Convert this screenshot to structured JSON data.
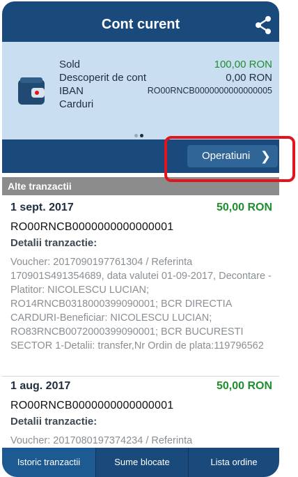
{
  "header": {
    "title": "Cont curent",
    "share_icon": "share-icon"
  },
  "account": {
    "icon": "wallet-icon",
    "sold_label": "Sold",
    "sold_value": "100,00 RON",
    "overdraft_label": "Descoperit de cont",
    "overdraft_value": "0,00 RON",
    "iban_label": "IBAN",
    "iban_value": "RO00RNCB0000000000000005",
    "cards_label": "Carduri",
    "pager": {
      "pages": 2,
      "active": 2
    }
  },
  "operations_button": {
    "label": "Operatiuni",
    "icon": "chevron-right-icon"
  },
  "section_title": "Alte tranzactii",
  "transactions": [
    {
      "date": "1 sept. 2017",
      "amount": "50,00 RON",
      "iban": "RO00RNCB0000000000000001",
      "details_label": "Detalii tranzactie:",
      "description": "Voucher: 2017090197761304 / Referinta 170901S491354689, data valutei 01-09-2017, Decontare -Platitor: NICOLESCU LUCIAN; RO14RNCB0318000399090001; BCR DIRECTIA CARDURI-Beneficiar: NICOLESCU LUCIAN; RO83RNCB0072000399090001; BCR BUCURESTI SECTOR 1-Detalii: transfer,Nr Ordin de plata:119796562"
    },
    {
      "date": "1 aug. 2017",
      "amount": "50,00 RON",
      "iban": "RO00RNCB0000000000000001",
      "details_label": "Detalii tranzactie:",
      "description": "Voucher: 2017080197374234 / Referinta"
    }
  ],
  "tabs": [
    {
      "label": "Istoric tranzactii",
      "active": true
    },
    {
      "label": "Sume blocate",
      "active": false
    },
    {
      "label": "Lista ordine",
      "active": false
    }
  ],
  "colors": {
    "header": "#1a4a7c",
    "account_bg": "#c9dff1",
    "amount": "#1e8f2d",
    "highlight": "#e2141c"
  }
}
